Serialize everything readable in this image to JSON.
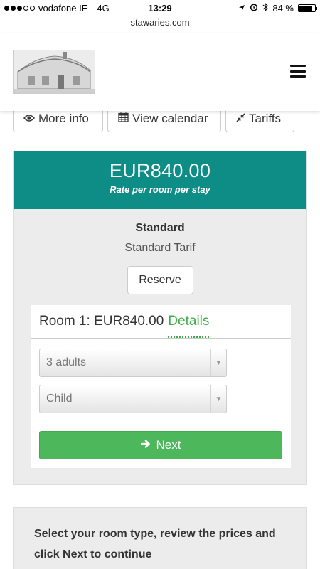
{
  "status_bar": {
    "carrier": "vodafone IE",
    "network": "4G",
    "time": "13:29",
    "battery": "84 %",
    "battery_level": 0.84
  },
  "browser": {
    "url": "stawaries.com"
  },
  "header": {
    "logo": "house-sketch-logo",
    "menu_icon": "hamburger-menu-icon"
  },
  "tabs": [
    {
      "label": "More info",
      "icon": "eye-icon"
    },
    {
      "label": "View calendar",
      "icon": "calendar-icon"
    },
    {
      "label": "Tariffs",
      "icon": "compress-arrows-icon"
    }
  ],
  "rate": {
    "amount": "EUR840.00",
    "subtitle": "Rate per room per stay",
    "color": "#0e8c86"
  },
  "room": {
    "name": "Standard",
    "tarif": "Standard Tarif",
    "reserve_label": "Reserve"
  },
  "booking": {
    "room_label": "Room 1: EUR840.00",
    "details_label": "Details",
    "adults_selected": "3 adults",
    "child_selected": "Child",
    "next_label": "Next",
    "next_color": "#4cb75b"
  },
  "help_text": "Select your room type, review the prices and click Next to continue"
}
